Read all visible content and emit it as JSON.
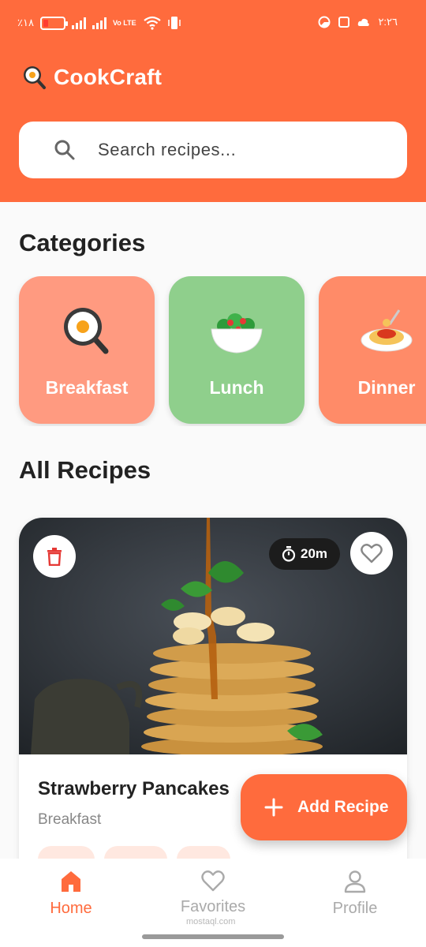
{
  "status_bar": {
    "battery_text": "٪١٨",
    "network_label": "Vo LTE",
    "time": "٢:٢٦"
  },
  "app": {
    "title": "CookCraft",
    "logo_icon": "frying-egg-icon",
    "accent_color": "#ff6b3d"
  },
  "search": {
    "placeholder": "Search recipes...",
    "value": ""
  },
  "categories": {
    "title": "Categories",
    "items": [
      {
        "label": "Breakfast",
        "icon": "frying-egg-icon",
        "color": "#ff9a80"
      },
      {
        "label": "Lunch",
        "icon": "salad-bowl-icon",
        "color": "#8fcf8c"
      },
      {
        "label": "Dinner",
        "icon": "spaghetti-icon",
        "color": "#ff8b68"
      }
    ]
  },
  "recipes": {
    "title": "All Recipes",
    "items": [
      {
        "name": "Strawberry Pancakes",
        "category": "Breakfast",
        "time": "20m",
        "favorite": false
      }
    ]
  },
  "fab": {
    "label": "Add Recipe"
  },
  "bottom_nav": {
    "items": [
      {
        "label": "Home",
        "icon": "home-icon",
        "active": true
      },
      {
        "label": "Favorites",
        "icon": "heart-icon",
        "active": false
      },
      {
        "label": "Profile",
        "icon": "person-icon",
        "active": false
      }
    ]
  },
  "watermark": "mostaql.com"
}
